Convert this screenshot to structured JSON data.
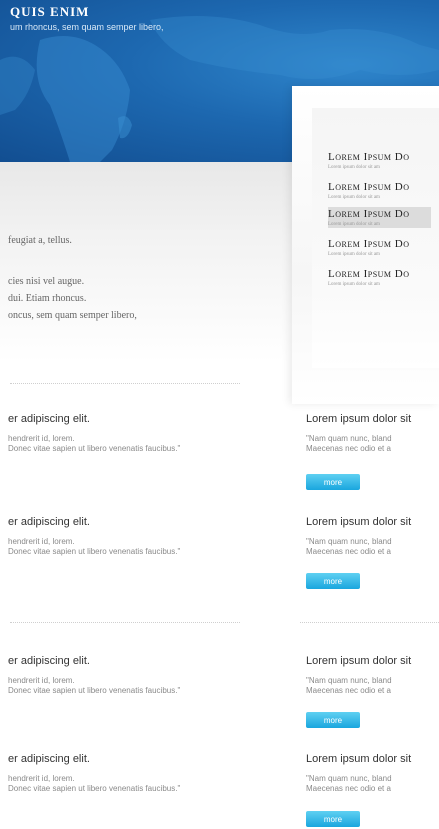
{
  "hero": {
    "title": "QUIS ENIM",
    "subtitle": "um rhoncus, sem quam semper libero,"
  },
  "intro": {
    "lines": [
      "feugiat a, tellus.",
      "cies nisi vel augue.",
      "dui. Etiam rhoncus.",
      "oncus, sem quam semper libero,"
    ]
  },
  "menu": {
    "items": [
      {
        "title": "Lorem Ipsum Do",
        "sub": "Lorem ipsum dolor sit am"
      },
      {
        "title": "Lorem Ipsum Do",
        "sub": "Lorem ipsum dolor sit am"
      },
      {
        "title": "Lorem Ipsum Do",
        "sub": "Lorem ipsum dolor sit am"
      },
      {
        "title": "Lorem Ipsum Do",
        "sub": "Lorem ipsum dolor sit am"
      },
      {
        "title": "Lorem Ipsum Do",
        "sub": "Lorem ipsum dolor sit am"
      }
    ]
  },
  "left_posts": [
    {
      "title": "er adipiscing elit.",
      "line1": "hendrerit id, lorem.",
      "line2": "Donec vitae sapien ut libero venenatis faucibus.\""
    },
    {
      "title": "er adipiscing elit.",
      "line1": "hendrerit id, lorem.",
      "line2": "Donec vitae sapien ut libero venenatis faucibus.\""
    },
    {
      "title": "er adipiscing elit.",
      "line1": "hendrerit id, lorem.",
      "line2": "Donec vitae sapien ut libero venenatis faucibus.\""
    },
    {
      "title": "er adipiscing elit.",
      "line1": "hendrerit id, lorem.",
      "line2": "Donec vitae sapien ut libero venenatis faucibus.\""
    }
  ],
  "right_posts": [
    {
      "title": "Lorem ipsum dolor sit",
      "line1": "\"Nam quam nunc, bland",
      "line2": "Maecenas nec odio et a",
      "button": "more"
    },
    {
      "title": "Lorem ipsum dolor sit",
      "line1": "\"Nam quam nunc, bland",
      "line2": "Maecenas nec odio et a",
      "button": "more"
    },
    {
      "title": "Lorem ipsum dolor sit",
      "line1": "\"Nam quam nunc, bland",
      "line2": "Maecenas nec odio et a",
      "button": "more"
    },
    {
      "title": "Lorem ipsum dolor sit",
      "line1": "\"Nam quam nunc, bland",
      "line2": "Maecenas nec odio et a",
      "button": "more"
    }
  ]
}
